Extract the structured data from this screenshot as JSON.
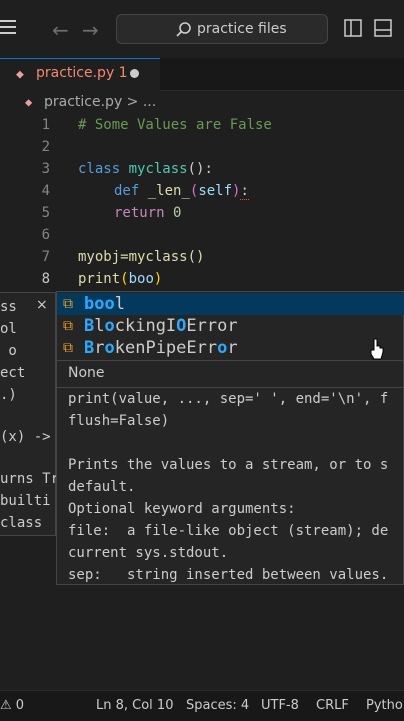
{
  "titlebar": {
    "search_text": "practice files"
  },
  "tab": {
    "label": "practice.py 1"
  },
  "breadcrumb": {
    "text": "practice.py > ..."
  },
  "editor": {
    "line_numbers": [
      "1",
      "2",
      "3",
      "4",
      "5",
      "6",
      "7",
      "8"
    ],
    "line1": "# Some Values are False",
    "line3_kw": "class",
    "line3_name": "myclass",
    "line3_rest": "():",
    "line4_kw": "def",
    "line4_name": "_len_",
    "line4_param": "self",
    "line5_kw": "return",
    "line5_num": "0",
    "line7": "myobj=myclass()",
    "line8_fn": "print",
    "line8_arg": "boo"
  },
  "hover_left": {
    "close": "×",
    "lines": [
      "ss",
      "ol",
      " o",
      "ect",
      ".)",
      "",
      "(x) ->",
      "",
      "urns Tr",
      "builti",
      "class"
    ]
  },
  "suggest": {
    "items": [
      {
        "match1": "boo",
        "rest1": "l",
        "match2": "",
        "rest2": ""
      },
      {
        "match1": "B",
        "rest1": "l",
        "match2": "o",
        "rest2": "ckingI",
        "match3": "O",
        "rest3": "Error"
      },
      {
        "match1": "B",
        "rest1": "r",
        "match2": "o",
        "rest2": "kenPipeErr",
        "match3": "o",
        "rest3": "r"
      }
    ]
  },
  "docs": {
    "none": "None",
    "lines": [
      "print(value, ..., sep=' ', end='\\n', f",
      "flush=False)",
      "",
      "Prints the values to a stream, or to s",
      "default.",
      "Optional keyword arguments:",
      "file:  a file-like object (stream); de",
      "current sys.stdout.",
      "sep:   string inserted between values."
    ]
  },
  "status": {
    "problems": "0",
    "position": "Ln 8, Col 10",
    "spaces": "Spaces: 4",
    "encoding": "UTF-8",
    "eol": "CRLF",
    "language": "Python"
  }
}
